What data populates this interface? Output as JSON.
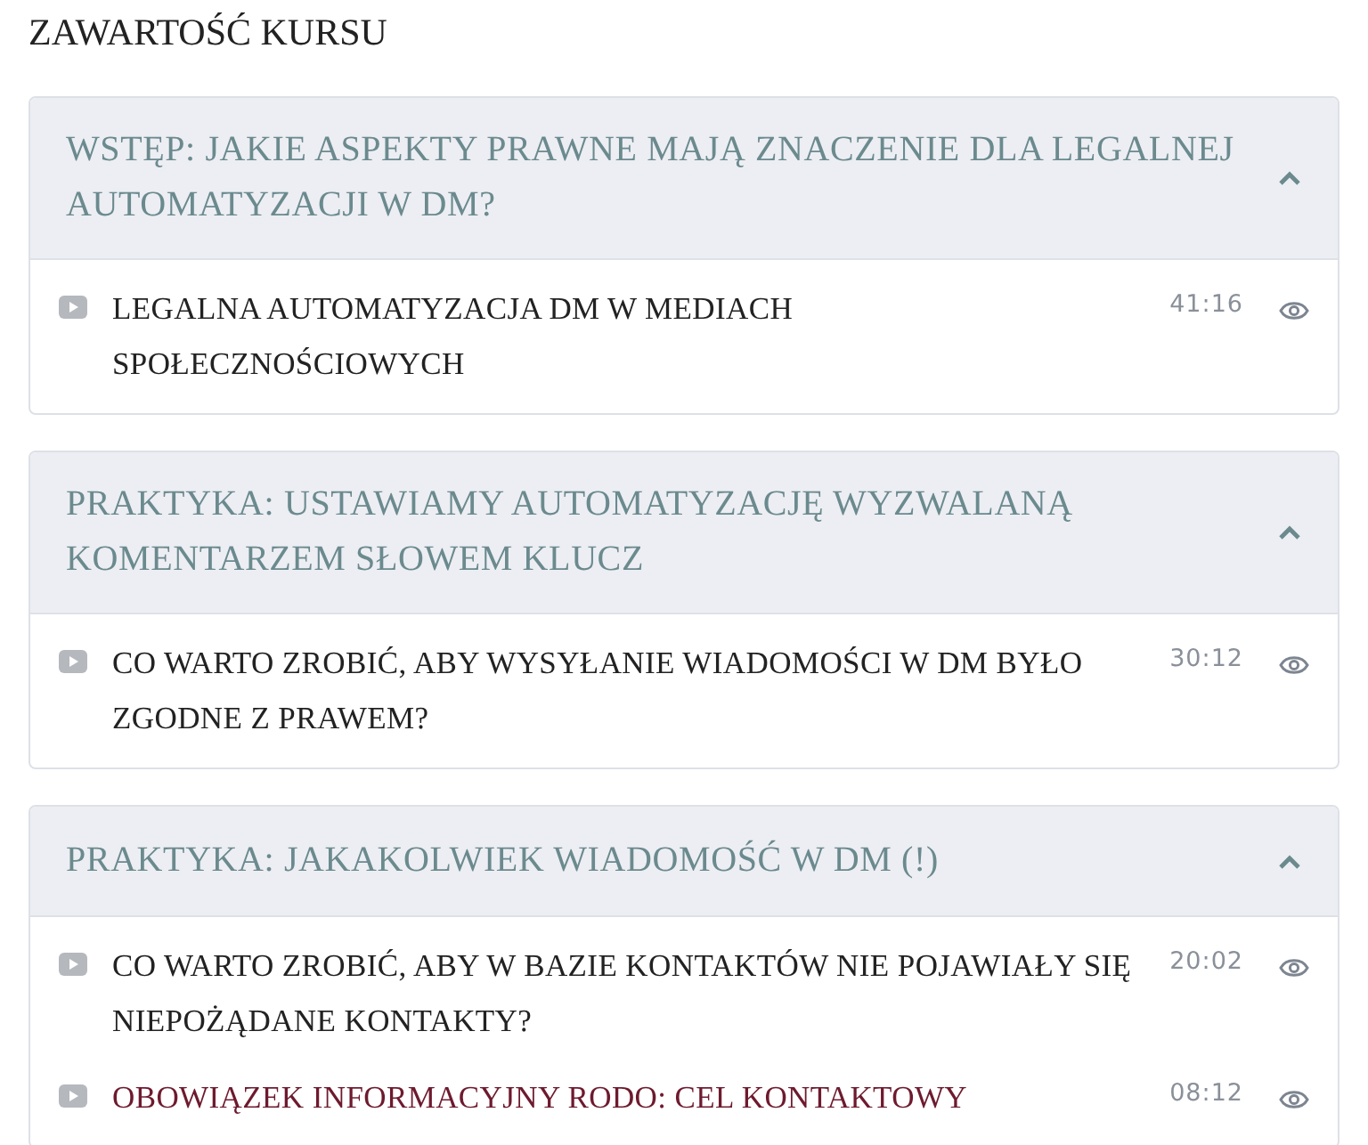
{
  "heading": "ZAWARTOŚĆ KURSU",
  "sections": [
    {
      "title": "WSTĘP: JAKIE ASPEKTY PRAWNE MAJĄ ZNACZENIE DLA LEGALNEJ AUTOMATYZACJI W DM?",
      "expanded": true,
      "lessons": [
        {
          "title": "LEGALNA AUTOMATYZACJA DM W MEDIACH SPOŁECZNOŚCIOWYCH",
          "duration": "41:16",
          "selected": false
        }
      ]
    },
    {
      "title": "PRAKTYKA: USTAWIAMY AUTOMATYZACJĘ WYZWALANĄ KOMENTARZEM SŁOWEM KLUCZ",
      "expanded": true,
      "lessons": [
        {
          "title": "CO WARTO ZROBIĆ, ABY WYSYŁANIE WIADOMOŚCI W DM BYŁO ZGODNE Z PRAWEM?",
          "duration": "30:12",
          "selected": false
        }
      ]
    },
    {
      "title": "PRAKTYKA: JAKAKOLWIEK WIADOMOŚĆ W DM (!)",
      "expanded": true,
      "lessons": [
        {
          "title": "CO WARTO ZROBIĆ, ABY W BAZIE KONTAKTÓW NIE POJAWIAŁY SIĘ NIEPOŻĄDANE KONTAKTY?",
          "duration": "20:02",
          "selected": false
        },
        {
          "title": "OBOWIĄZEK INFORMACYJNY RODO: CEL KONTAKTOWY",
          "duration": "08:12",
          "selected": true
        }
      ]
    }
  ]
}
